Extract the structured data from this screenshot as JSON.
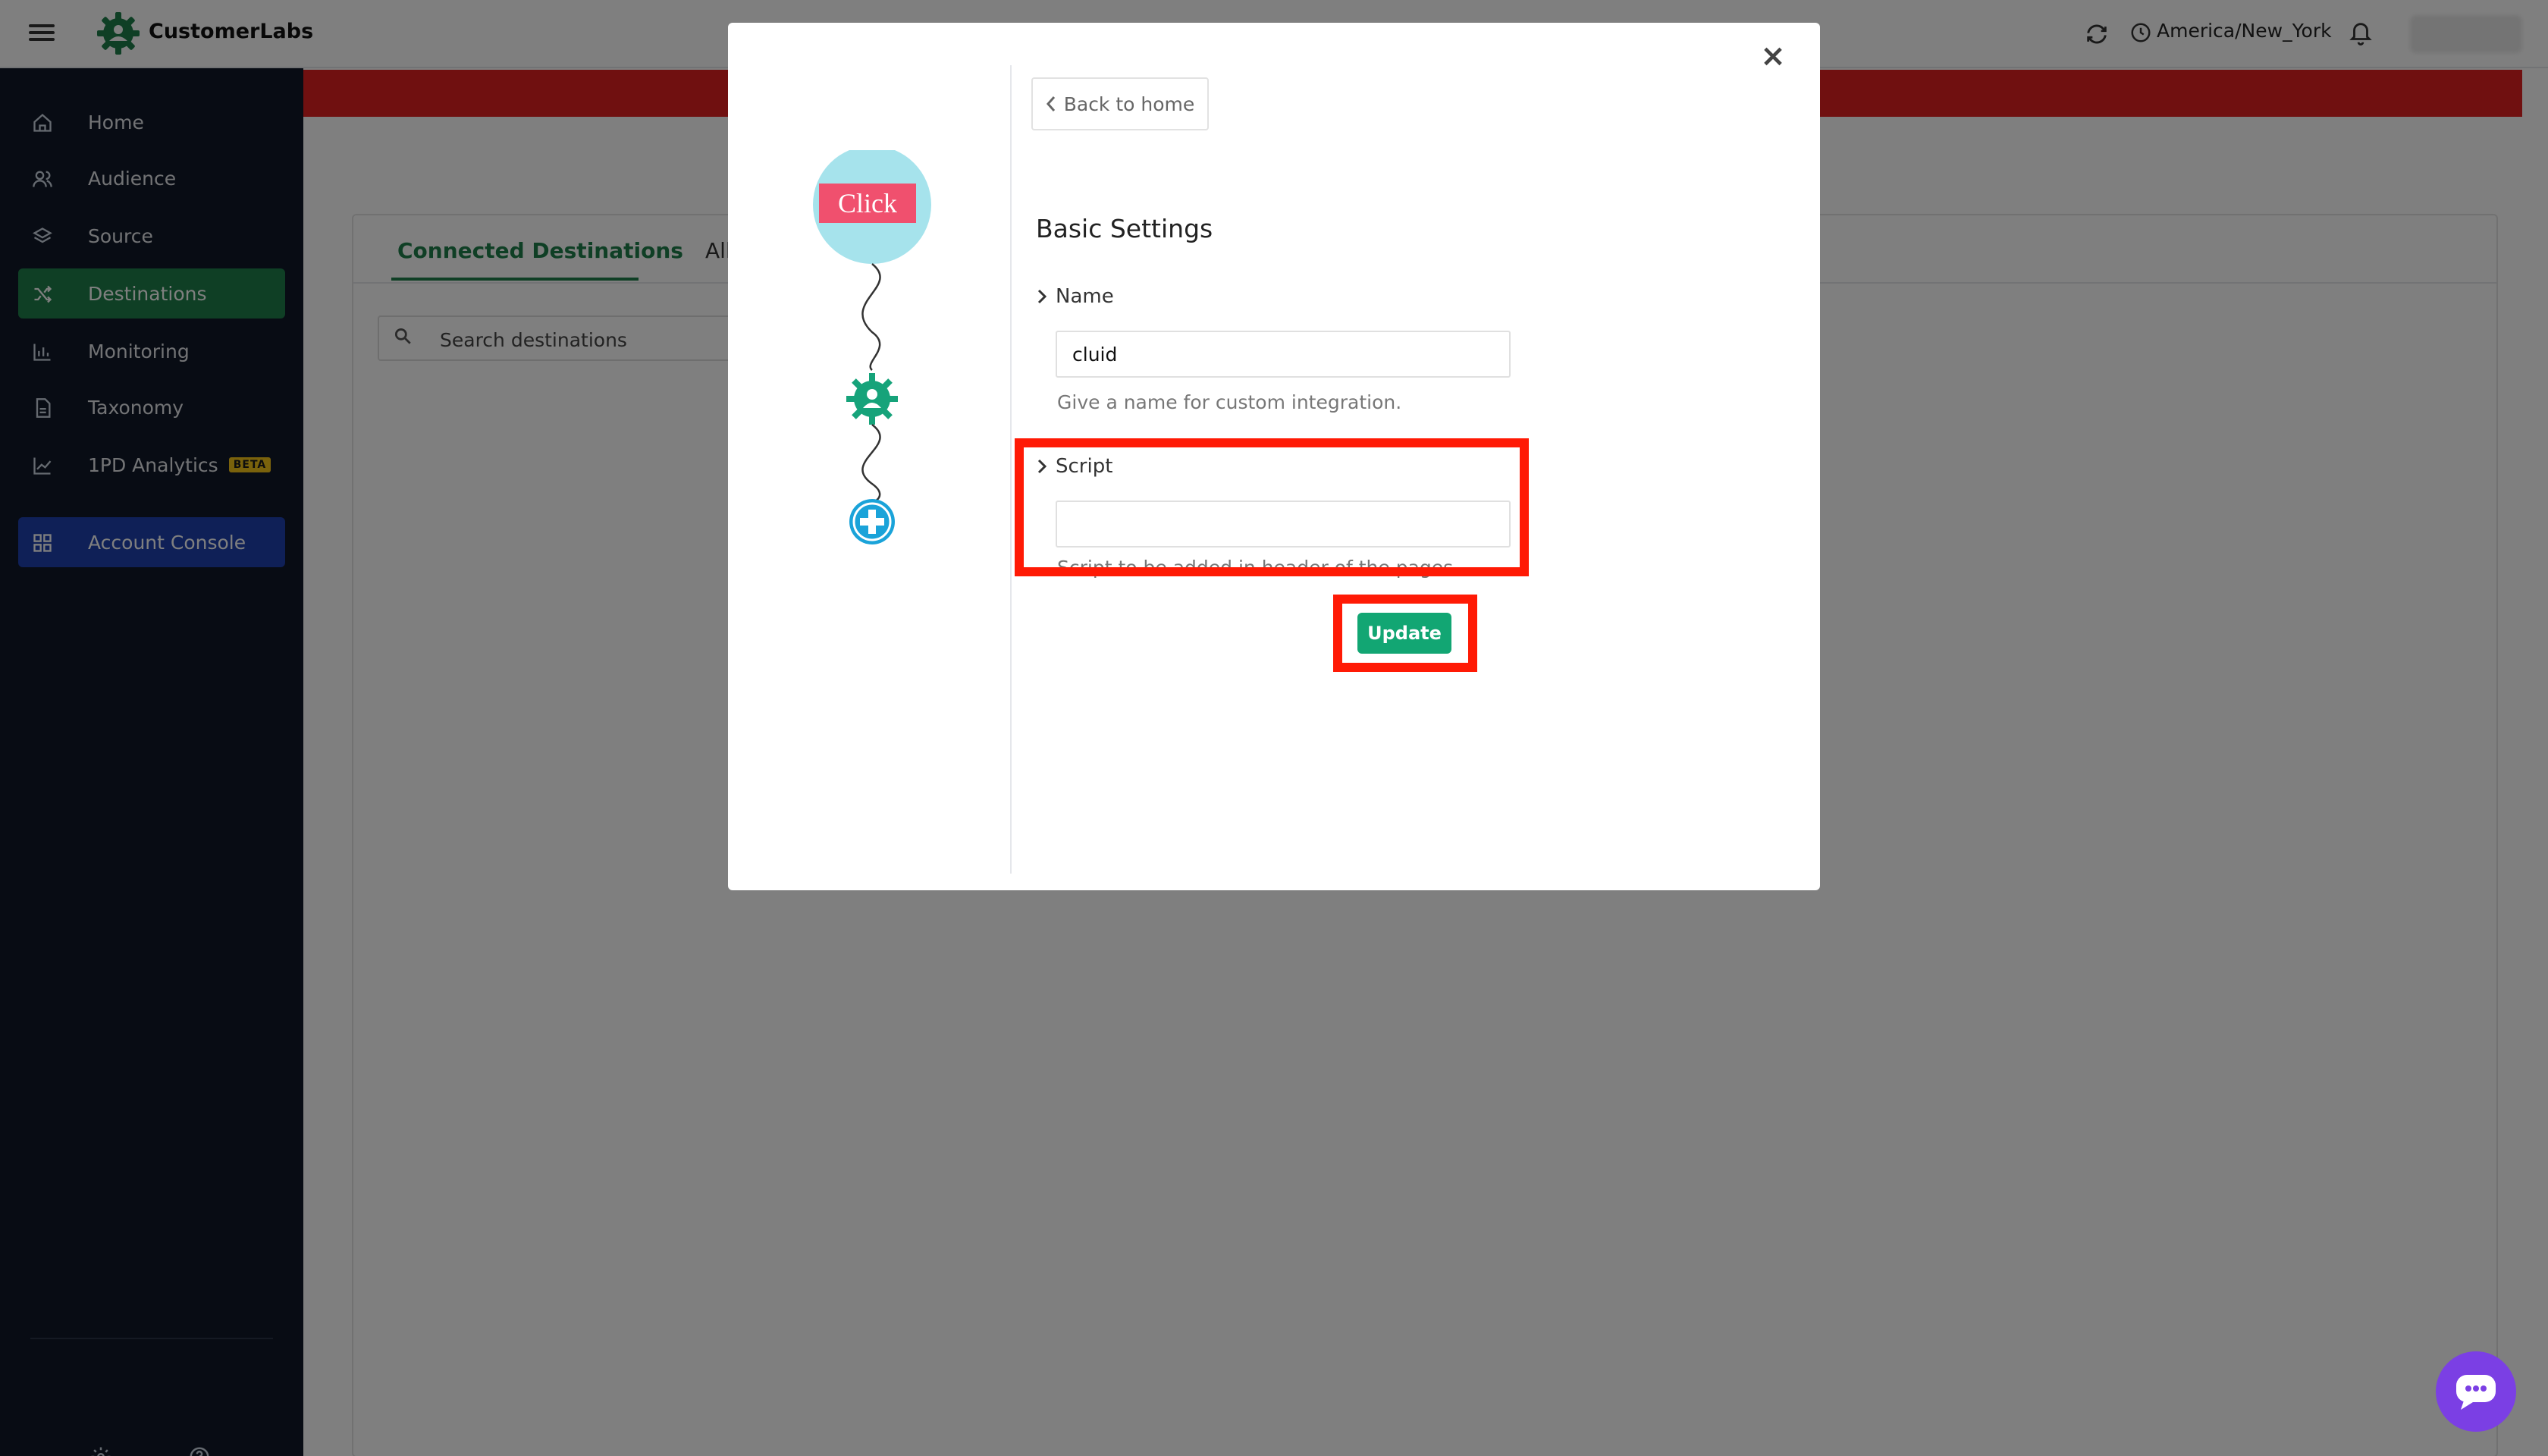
{
  "header": {
    "brand_name": "CustomerLabs",
    "timezone": "America/New_York"
  },
  "sidebar": {
    "items": [
      {
        "label": "Home",
        "icon": "home-icon"
      },
      {
        "label": "Audience",
        "icon": "users-icon"
      },
      {
        "label": "Source",
        "icon": "layers-icon"
      },
      {
        "label": "Destinations",
        "icon": "shuffle-icon",
        "active": true
      },
      {
        "label": "Monitoring",
        "icon": "bar-chart-icon"
      },
      {
        "label": "Taxonomy",
        "icon": "document-icon"
      },
      {
        "label": "1PD Analytics",
        "icon": "trend-icon",
        "badge": "BETA"
      }
    ],
    "account_console": "Account Console"
  },
  "main": {
    "tabs": [
      "Connected Destinations",
      "All"
    ],
    "search_placeholder": "Search destinations"
  },
  "modal": {
    "back_label": "Back to home",
    "flow_label": "Click",
    "section_title": "Basic Settings",
    "name_label": "Name",
    "name_value": "cluid",
    "name_help": "Give a name for custom integration.",
    "script_label": "Script",
    "script_value": "",
    "script_help": "Script to be added in header of the pages.",
    "update_label": "Update",
    "close_symbol": "×"
  },
  "colors": {
    "brand_green": "#1e7e4a",
    "update_green": "#12a673",
    "alert_red": "#e02020",
    "highlight_red": "#ff1a05",
    "console_blue": "#1e40af",
    "sidebar_bg": "#101828",
    "chat_purple": "#7b3fe4"
  }
}
